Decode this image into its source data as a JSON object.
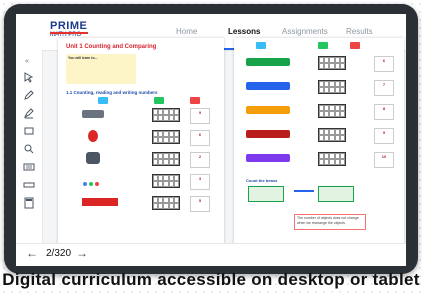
{
  "app": {
    "logo_primary": "PRIME",
    "logo_secondary": "MATH PRO"
  },
  "nav": {
    "items": [
      {
        "label": "Home"
      },
      {
        "label": "Lessons"
      },
      {
        "label": "Assignments"
      },
      {
        "label": "Results"
      }
    ],
    "active": "Lessons"
  },
  "book": {
    "unit_title": "Unit 1 Counting and Comparing",
    "learn_box_heading": "You will learn to...",
    "section_title": "1.1 Counting, reading and writing numbers",
    "right_section": "Count the beans"
  },
  "pager": {
    "current": "2/320",
    "prev_icon": "arrow-left-icon",
    "next_icon": "arrow-right-icon"
  },
  "counters": {
    "left": [
      "9",
      "6",
      "2",
      "3",
      "5"
    ],
    "right": [
      "6",
      "7",
      "8",
      "9",
      "10"
    ]
  },
  "footer_note": "The number of objects does not change when we rearrange the objects.",
  "caption": "Digital curriculum accessible on desktop or tablet"
}
